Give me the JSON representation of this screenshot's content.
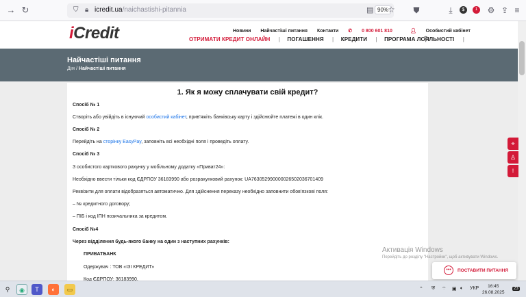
{
  "browser": {
    "url_domain": "icredit.ua",
    "url_path": "/naichastishi-pitannia",
    "zoom": "90%",
    "badge_count": "1"
  },
  "header": {
    "logo_i": "i",
    "logo_rest": "Credit",
    "top_links": [
      "Новини",
      "Найчастіші питання",
      "Контакти"
    ],
    "phone": "0 800 601 810",
    "cabinet": "Особистий кабінет",
    "get_credit": "ОТРИМАТИ КРЕДИТ ОНЛАЙН",
    "repay": "ПОГАШЕННЯ",
    "credits": "КРЕДИТИ",
    "loyalty": "ПРОГРАМА ЛОЯЛЬНОСТІ",
    "sep": "|"
  },
  "banner": {
    "title": "Найчастіші питання",
    "crumb_home": "Дім",
    "crumb_sep": "/",
    "crumb_current": "Найчастіші питання"
  },
  "content": {
    "question": "1. Як я можу сплачувати свій кредит?",
    "m1_title": "Спосіб № 1",
    "m1_pre": "Створіть або увійдіть в існуючий ",
    "m1_link": "особистий кабінет",
    "m1_post": ", прив’яжіть банківську карту і здійснюйте платежі в один клік.",
    "m2_title": "Спосіб № 2",
    "m2_pre": "Перейдіть на ",
    "m2_link": "сторінку EasyPay",
    "m2_post": ", заповніть всі необхідні поля і проведіть оплату.",
    "m3_title": "Спосіб № 3",
    "m3_line1": "З особистого карткового рахунку у мобільному додатку «Приват24»:",
    "m3_line2": "Необхідно ввести тільки код ЄДРПОУ 36183990 або розрахунковий рахунок:  UA763052990000026502036701409",
    "m3_line3": "Реквізити для оплати відобразяться автоматично. Для здійснення переказу необхідно заповнити обов’язкові поля:",
    "m3_line4": "– № кредитного договору;",
    "m3_line5": "– ПІБ і код ІПН позичальника за кредитом.",
    "m4_title": "Спосіб №4",
    "m4_line1": "Через відділення будь-якого банку на один з наступних рахунків:",
    "bank": "ПРИВАТБАНК",
    "recipient": "Одержувач : ТОВ «ІЗІ КРЕДИТ»",
    "edrpou": "Код ЄДРПОУ: 36183990,"
  },
  "ask_button": "ПОСТАВИТИ ПИТАННЯ",
  "watermark": {
    "title": "Активація Windows",
    "text": "Перейдіть до розділу \"Настройки\", щоб активувати Windows."
  },
  "taskbar": {
    "lang": "УКР",
    "time": "16:45",
    "date": "26.08.2025",
    "notif": "23"
  },
  "colors": {
    "brand_red": "#d31a38",
    "banner": "#5b6a73",
    "link": "#1a73e8"
  }
}
